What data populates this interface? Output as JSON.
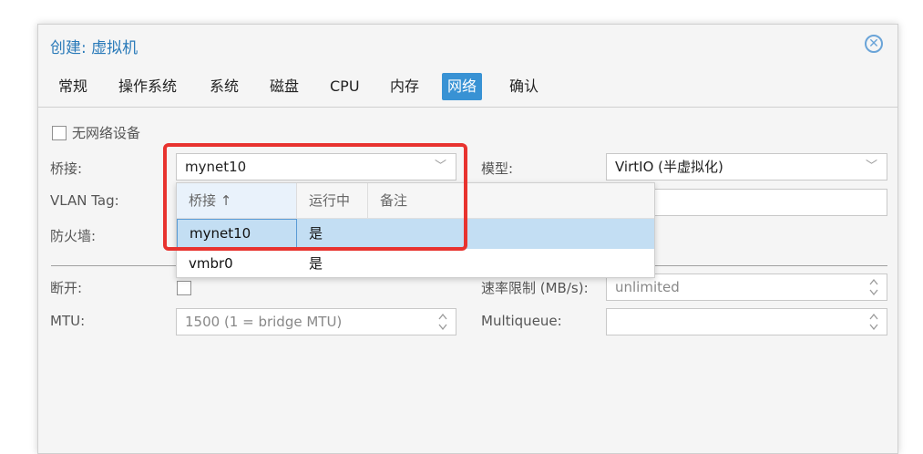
{
  "dialog": {
    "title": "创建: 虚拟机",
    "close_icon": "close-circle-icon"
  },
  "tabs": [
    {
      "label": "常规"
    },
    {
      "label": "操作系统"
    },
    {
      "label": "系统"
    },
    {
      "label": "磁盘"
    },
    {
      "label": "CPU"
    },
    {
      "label": "内存"
    },
    {
      "label": "网络",
      "active": true
    },
    {
      "label": "确认"
    }
  ],
  "form": {
    "no_network_label": "无网络设备",
    "bridge_label": "桥接:",
    "bridge_value": "mynet10",
    "vlan_label": "VLAN Tag:",
    "firewall_label": "防火墙:",
    "model_label": "模型:",
    "model_value": "VirtIO (半虚拟化)",
    "mac_value": "",
    "disconnect_label": "断开:",
    "rate_label": "速率限制 (MB/s):",
    "rate_placeholder": "unlimited",
    "mtu_label": "MTU:",
    "mtu_placeholder": "1500 (1 = bridge MTU)",
    "multiqueue_label": "Multiqueue:",
    "multiqueue_value": ""
  },
  "bridge_dropdown": {
    "columns": [
      "桥接 ↑",
      "运行中",
      "备注"
    ],
    "rows": [
      {
        "bridge": "mynet10",
        "active": "是",
        "comment": "",
        "selected": true
      },
      {
        "bridge": "vmbr0",
        "active": "是",
        "comment": ""
      }
    ]
  },
  "colors": {
    "accent": "#3892d4",
    "title": "#2a7ab9",
    "highlight_box": "#e8332f",
    "selected_row": "#c3def3"
  }
}
